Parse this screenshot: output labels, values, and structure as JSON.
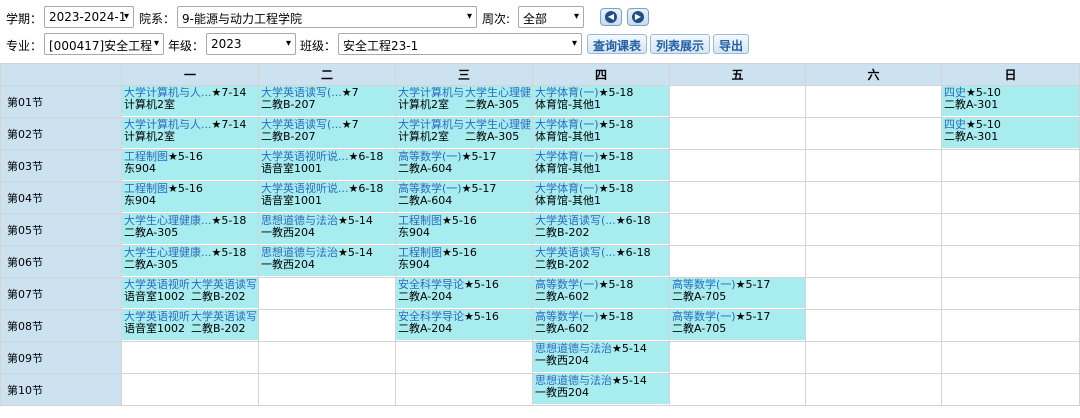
{
  "filters": {
    "term_label": "学期：",
    "term_value": "2023-2024-1",
    "dept_label": "院系：",
    "dept_value": "9-能源与动力工程学院",
    "week_label": "周次:",
    "week_value": "全部",
    "major_label": "专业：",
    "major_value": "[000417]安全工程",
    "grade_label": "年级：",
    "grade_value": "2023",
    "class_label": "班级：",
    "class_value": "安全工程23-1",
    "btn_query": "查询课表",
    "btn_list": "列表展示",
    "btn_export": "导出",
    "arrow": "▾",
    "prev_icon": "◀",
    "next_icon": "▶"
  },
  "table": {
    "days": [
      "一",
      "二",
      "三",
      "四",
      "五",
      "六",
      "日"
    ],
    "slots": [
      "第01节",
      "第02节",
      "第03节",
      "第04节",
      "第05节",
      "第06节",
      "第07节",
      "第08节",
      "第09节",
      "第10节"
    ],
    "cells": [
      [
        {
          "course": "大学计算机与人...",
          "weeks": "★7-14",
          "room": "计算机2室"
        },
        {
          "course": "大学英语读写(...",
          "weeks": "★7",
          "room": "二教B-207"
        },
        {
          "split": [
            {
              "course": "大学计算机与",
              "room": "计算机2室"
            },
            {
              "course": "大学生心理健",
              "room": "二教A-305"
            }
          ]
        },
        {
          "course": "大学体育(一)",
          "weeks": "★5-18",
          "room": "体育馆-其他1"
        },
        null,
        null,
        {
          "course": "四史",
          "weeks": "★5-10",
          "room": "二教A-301"
        }
      ],
      [
        {
          "course": "大学计算机与人...",
          "weeks": "★7-14",
          "room": "计算机2室"
        },
        {
          "course": "大学英语读写(...",
          "weeks": "★7",
          "room": "二教B-207"
        },
        {
          "split": [
            {
              "course": "大学计算机与",
              "room": "计算机2室"
            },
            {
              "course": "大学生心理健",
              "room": "二教A-305"
            }
          ]
        },
        {
          "course": "大学体育(一)",
          "weeks": "★5-18",
          "room": "体育馆-其他1"
        },
        null,
        null,
        {
          "course": "四史",
          "weeks": "★5-10",
          "room": "二教A-301"
        }
      ],
      [
        {
          "course": "工程制图",
          "weeks": "★5-16",
          "room": "东904"
        },
        {
          "course": "大学英语视听说...",
          "weeks": "★6-18",
          "room": "语音室1001"
        },
        {
          "course": "高等数学(一)",
          "weeks": "★5-17",
          "room": "二教A-604"
        },
        {
          "course": "大学体育(一)",
          "weeks": "★5-18",
          "room": "体育馆-其他1"
        },
        null,
        null,
        null
      ],
      [
        {
          "course": "工程制图",
          "weeks": "★5-16",
          "room": "东904"
        },
        {
          "course": "大学英语视听说...",
          "weeks": "★6-18",
          "room": "语音室1001"
        },
        {
          "course": "高等数学(一)",
          "weeks": "★5-17",
          "room": "二教A-604"
        },
        {
          "course": "大学体育(一)",
          "weeks": "★5-18",
          "room": "体育馆-其他1"
        },
        null,
        null,
        null
      ],
      [
        {
          "course": "大学生心理健康...",
          "weeks": "★5-18",
          "room": "二教A-305"
        },
        {
          "course": "思想道德与法治",
          "weeks": "★5-14",
          "room": "一教西204"
        },
        {
          "course": "工程制图",
          "weeks": "★5-16",
          "room": "东904"
        },
        {
          "course": "大学英语读写(...",
          "weeks": "★6-18",
          "room": "二教B-202"
        },
        null,
        null,
        null
      ],
      [
        {
          "course": "大学生心理健康...",
          "weeks": "★5-18",
          "room": "二教A-305"
        },
        {
          "course": "思想道德与法治",
          "weeks": "★5-14",
          "room": "一教西204"
        },
        {
          "course": "工程制图",
          "weeks": "★5-16",
          "room": "东904"
        },
        {
          "course": "大学英语读写(...",
          "weeks": "★6-18",
          "room": "二教B-202"
        },
        null,
        null,
        null
      ],
      [
        {
          "split": [
            {
              "course": "大学英语视听",
              "room": "语音室1002"
            },
            {
              "course": "大学英语读写",
              "room": "二教B-202"
            }
          ]
        },
        null,
        {
          "course": "安全科学导论",
          "weeks": "★5-16",
          "room": "二教A-204"
        },
        {
          "course": "高等数学(一)",
          "weeks": "★5-18",
          "room": "二教A-602"
        },
        {
          "course": "高等数学(一)",
          "weeks": "★5-17",
          "room": "二教A-705"
        },
        null,
        null
      ],
      [
        {
          "split": [
            {
              "course": "大学英语视听",
              "room": "语音室1002"
            },
            {
              "course": "大学英语读写",
              "room": "二教B-202"
            }
          ]
        },
        null,
        {
          "course": "安全科学导论",
          "weeks": "★5-16",
          "room": "二教A-204"
        },
        {
          "course": "高等数学(一)",
          "weeks": "★5-18",
          "room": "二教A-602"
        },
        {
          "course": "高等数学(一)",
          "weeks": "★5-17",
          "room": "二教A-705"
        },
        null,
        null
      ],
      [
        null,
        null,
        null,
        {
          "course": "思想道德与法治",
          "weeks": "★5-14",
          "room": "一教西204"
        },
        null,
        null,
        null
      ],
      [
        null,
        null,
        null,
        {
          "course": "思想道德与法治",
          "weeks": "★5-14",
          "room": "一教西204"
        },
        null,
        null,
        null
      ]
    ]
  }
}
